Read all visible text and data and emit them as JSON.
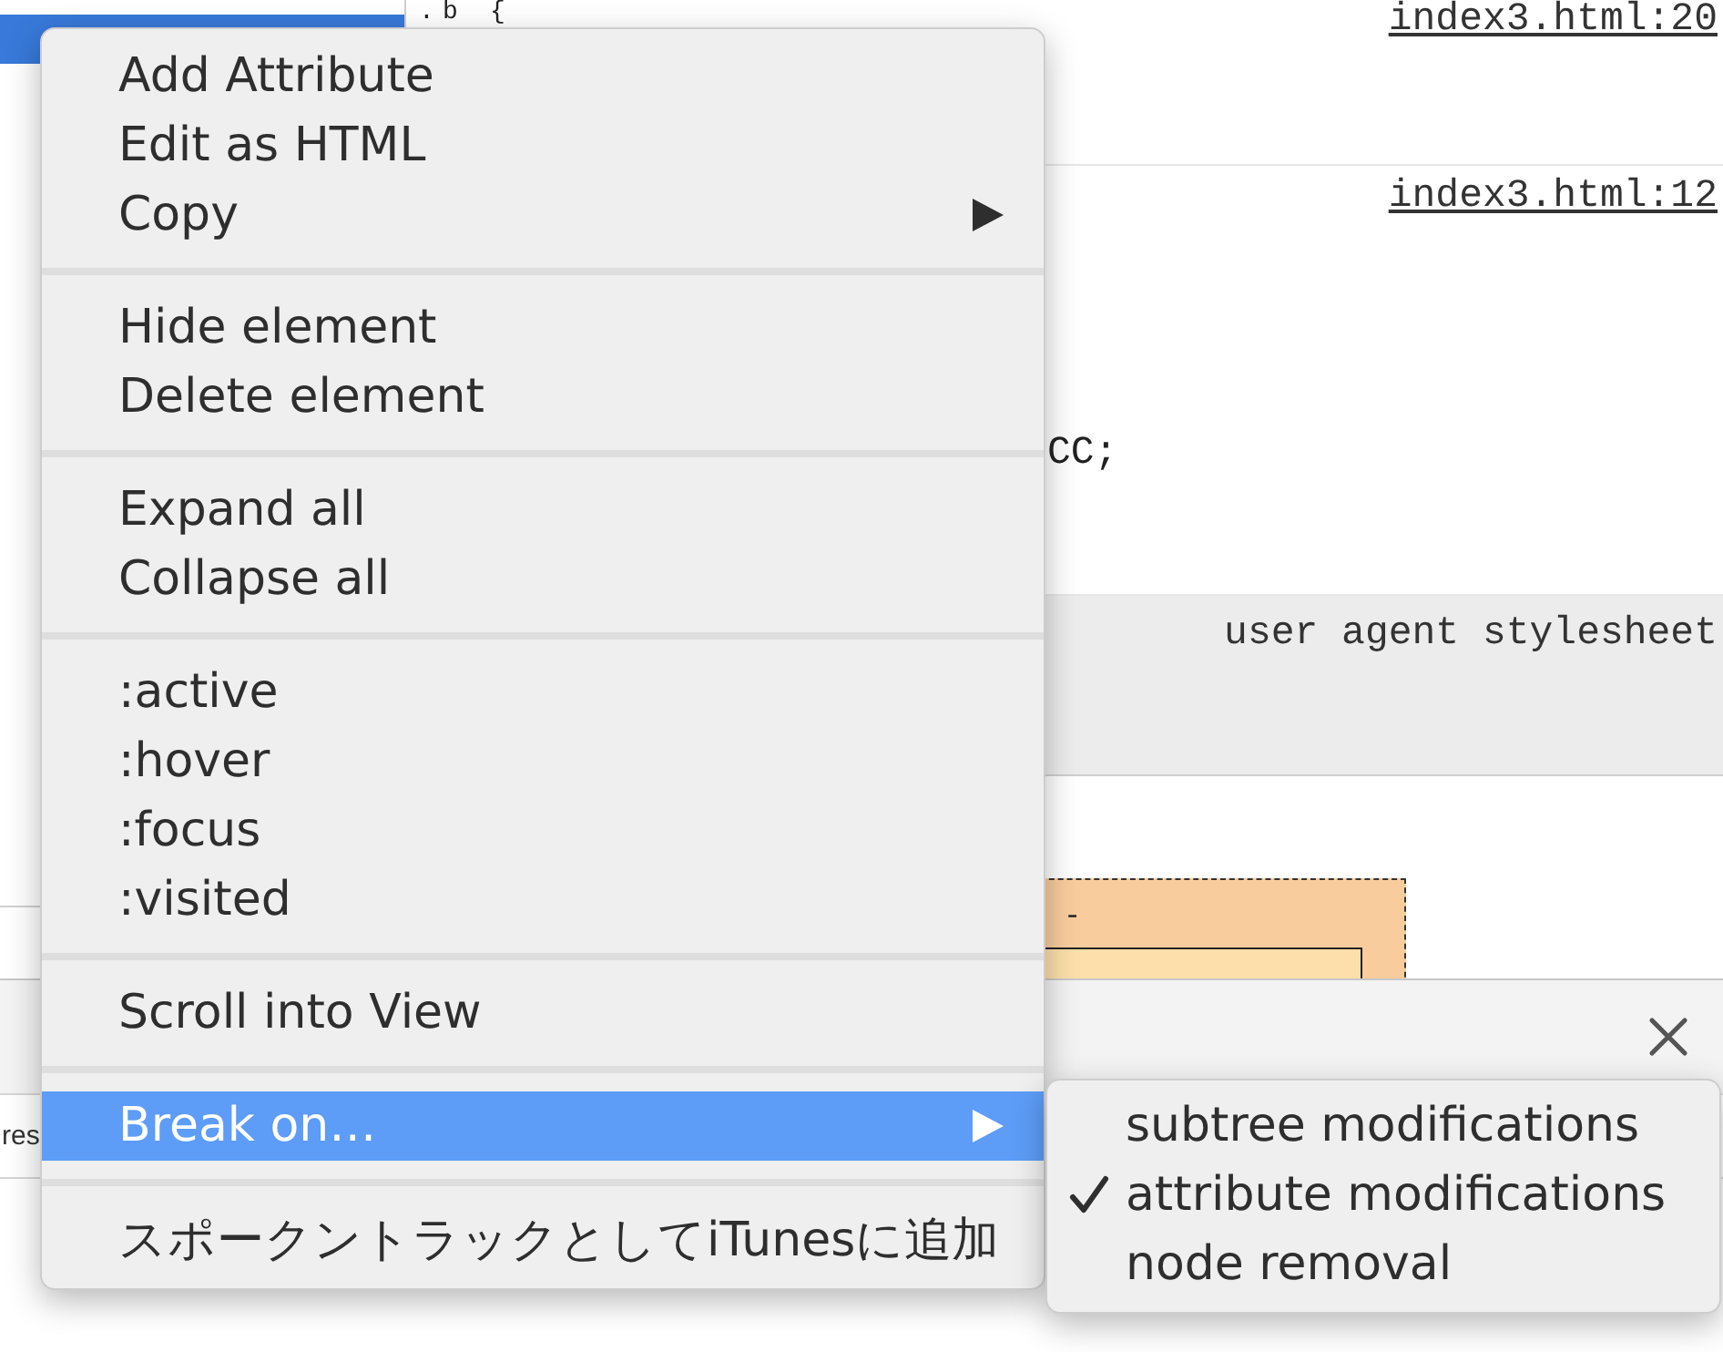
{
  "elements_panel": {
    "rows": [
      {
        "selected": true
      }
    ]
  },
  "styles_pane": {
    "rules": [
      {
        "kind": "rule",
        "selector": ".b {",
        "source": "index3.html:20"
      },
      {
        "kind": "rule",
        "source": "index3.html:12",
        "lines": [
          "CC;"
        ]
      },
      {
        "kind": "user-agent",
        "source": "user agent stylesheet"
      }
    ]
  },
  "box_model": {
    "margin": "-"
  },
  "drawer": {
    "text": "res"
  },
  "context_menu": {
    "groups": [
      {
        "items": [
          {
            "label": "Add Attribute",
            "submenu": false,
            "selected": false
          },
          {
            "label": "Edit as HTML",
            "submenu": false,
            "selected": false
          },
          {
            "label": "Copy",
            "submenu": true,
            "selected": false
          }
        ]
      },
      {
        "items": [
          {
            "label": "Hide element",
            "submenu": false,
            "selected": false
          },
          {
            "label": "Delete element",
            "submenu": false,
            "selected": false
          }
        ]
      },
      {
        "items": [
          {
            "label": "Expand all",
            "submenu": false,
            "selected": false
          },
          {
            "label": "Collapse all",
            "submenu": false,
            "selected": false
          }
        ]
      },
      {
        "items": [
          {
            "label": ":active",
            "submenu": false,
            "selected": false
          },
          {
            "label": ":hover",
            "submenu": false,
            "selected": false
          },
          {
            "label": ":focus",
            "submenu": false,
            "selected": false
          },
          {
            "label": ":visited",
            "submenu": false,
            "selected": false
          }
        ]
      },
      {
        "items": [
          {
            "label": "Scroll into View",
            "submenu": false,
            "selected": false
          }
        ]
      },
      {
        "items": [
          {
            "label": "Break on…",
            "submenu": true,
            "selected": true
          }
        ]
      },
      {
        "items": [
          {
            "label": "スポークントラックとしてiTunesに追加",
            "submenu": false,
            "selected": false
          }
        ]
      }
    ]
  },
  "submenu": {
    "items": [
      {
        "label": "subtree modifications",
        "checked": false
      },
      {
        "label": "attribute modifications",
        "checked": true
      },
      {
        "label": "node removal",
        "checked": false
      }
    ]
  }
}
